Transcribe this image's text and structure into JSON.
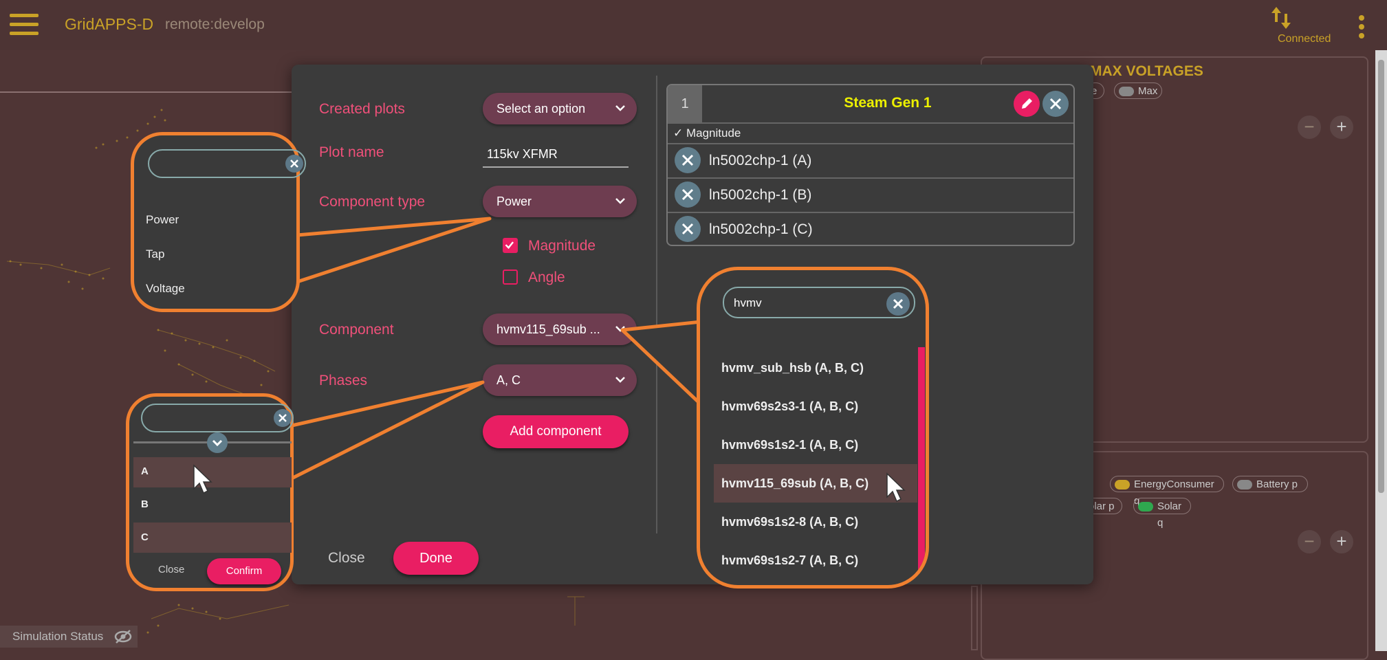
{
  "topbar": {
    "app_title": "GridAPPS-D",
    "app_subtitle": "remote:develop",
    "connection_status": "Connected"
  },
  "background": {
    "panel_title": "MAX VOLTAGES",
    "chips_top": [
      {
        "label": "e",
        "color": "#8a7575"
      },
      {
        "label": "Max",
        "color": "#888888"
      }
    ],
    "chips_bottom": [
      {
        "label": "EnergyConsumer q",
        "color": "#c9a227"
      },
      {
        "label": "Battery p",
        "color": "#888888"
      },
      {
        "label": "olar p",
        "color": "#8a7575"
      },
      {
        "label": "Solar q",
        "color": "#2fa84f"
      }
    ],
    "sim_status": "Simulation Status"
  },
  "dialog": {
    "created_plots_label": "Created plots",
    "created_plots_value": "Select an option",
    "plot_name_label": "Plot name",
    "plot_name_value": "115kv XFMR",
    "component_type_label": "Component type",
    "component_type_value": "Power",
    "magnitude_label": "Magnitude",
    "magnitude_checked": true,
    "angle_label": "Angle",
    "angle_checked": false,
    "component_label": "Component",
    "component_value": "hvmv115_69sub ...",
    "phases_label": "Phases",
    "phases_value": "A, C",
    "add_component_label": "Add component",
    "close_label": "Close",
    "done_label": "Done"
  },
  "plot_card": {
    "number": "1",
    "name": "Steam Gen 1",
    "magnitude_label": "✓ Magnitude",
    "rows": [
      "ln5002chp-1 (A)",
      "ln5002chp-1 (B)",
      "ln5002chp-1 (C)"
    ]
  },
  "component_type_callout": {
    "search_value": "",
    "options": [
      "Power",
      "Tap",
      "Voltage"
    ]
  },
  "phases_callout": {
    "search_value": "",
    "options": [
      "A",
      "B",
      "C"
    ],
    "selected": [
      "A",
      "C"
    ],
    "close_label": "Close",
    "confirm_label": "Confirm"
  },
  "component_callout": {
    "search_value": "hvmv",
    "options": [
      "hvmv_sub_hsb (A, B, C)",
      "hvmv69s2s3-1 (A, B, C)",
      "hvmv69s1s2-1 (A, B, C)",
      "hvmv115_69sub (A, B, C)",
      "hvmv69s1s2-8 (A, B, C)",
      "hvmv69s1s2-7 (A, B, C)"
    ],
    "highlighted": "hvmv115_69sub (A, B, C)"
  },
  "colors": {
    "accent_pink": "#e91e63",
    "gold": "#c9a227",
    "callout_orange": "#f08030",
    "plot_title_yellow": "#ecf000"
  }
}
